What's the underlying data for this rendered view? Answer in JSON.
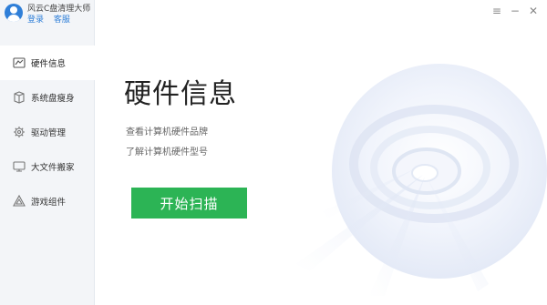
{
  "app": {
    "title": "风云C盘清理大师",
    "login_label": "登录",
    "support_label": "客服",
    "accent_color": "#2f7fd8",
    "button_color": "#2cb455"
  },
  "window_controls": {
    "menu": "≡",
    "minimize": "−",
    "close": "✕"
  },
  "sidebar": {
    "items": [
      {
        "label": "硬件信息",
        "icon": "hardware-info-icon",
        "active": true
      },
      {
        "label": "系统盘瘦身",
        "icon": "system-disk-slim-icon",
        "active": false
      },
      {
        "label": "驱动管理",
        "icon": "driver-gear-icon",
        "active": false
      },
      {
        "label": "大文件搬家",
        "icon": "large-file-move-icon",
        "active": false
      },
      {
        "label": "游戏组件",
        "icon": "game-component-icon",
        "active": false
      }
    ]
  },
  "main": {
    "title": "硬件信息",
    "desc1": "查看计算机硬件品牌",
    "desc2": "了解计算机硬件型号",
    "scan_button": "开始扫描"
  }
}
